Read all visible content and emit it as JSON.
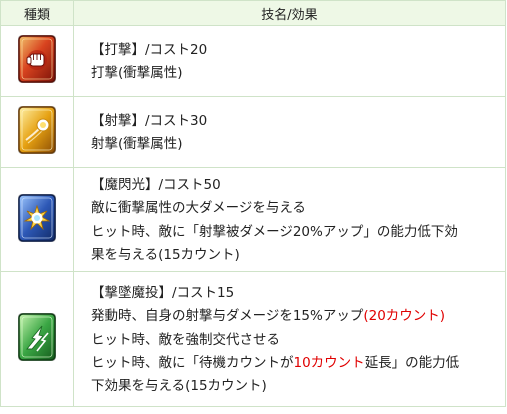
{
  "header": {
    "type_col": "種類",
    "name_col": "技名/効果"
  },
  "rows": [
    {
      "icon": "fist-card-icon",
      "color": "#c0301a",
      "lines": [
        [
          {
            "t": "【打撃】/コスト20"
          }
        ],
        [
          {
            "t": "打撃(衝撃属性)"
          }
        ]
      ]
    },
    {
      "icon": "shot-card-icon",
      "color": "#e2a010",
      "lines": [
        [
          {
            "t": "【射撃】/コスト30"
          }
        ],
        [
          {
            "t": "射撃(衝撃属性)"
          }
        ]
      ]
    },
    {
      "icon": "burst-card-icon",
      "color": "#2a4fa8",
      "lines": [
        [
          {
            "t": "【魔閃光】/コスト50"
          }
        ],
        [
          {
            "t": "敵に衝撃属性の大ダメージを与える"
          }
        ],
        [
          {
            "t": "ヒット時、敵に「射撃被ダメージ20%アップ」の能力低下効"
          }
        ],
        [
          {
            "t": "果を与える(15カウント)"
          }
        ]
      ]
    },
    {
      "icon": "beam-card-icon",
      "color": "#2f9a3a",
      "lines": [
        [
          {
            "t": "【撃墜魔投】/コスト15"
          }
        ],
        [
          {
            "t": "発動時、自身の射撃与ダメージを15%アップ"
          },
          {
            "t": "(20カウント)",
            "hl": true
          }
        ],
        [
          {
            "t": "ヒット時、敵を強制交代させる"
          }
        ],
        [
          {
            "t": "ヒット時、敵に「待機カウントが"
          },
          {
            "t": "10カウント",
            "hl": true
          },
          {
            "t": "延長」の能力低"
          }
        ],
        [
          {
            "t": "下効果を与える(15カウント)"
          }
        ]
      ]
    }
  ]
}
